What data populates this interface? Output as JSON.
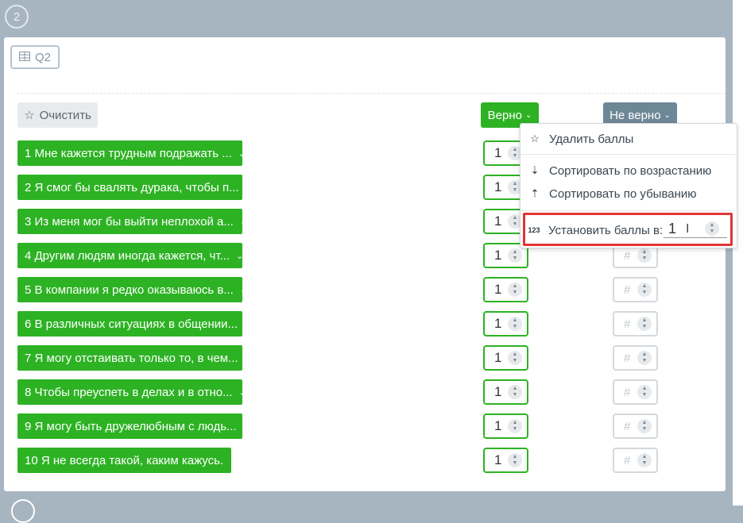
{
  "step_number": "2",
  "tag": {
    "label": "Q2"
  },
  "toolbar": {
    "clear_label": "Очистить"
  },
  "columns": {
    "true_label": "Верно",
    "false_label": "Не верно"
  },
  "questions": [
    {
      "label": "1 Мне кажется трудным подражать ...",
      "true_score": "1",
      "false_score": "#"
    },
    {
      "label": "2 Я смог бы свалять дурака, чтобы п...",
      "true_score": "1",
      "false_score": "#"
    },
    {
      "label": "3 Из меня мог бы выйти неплохой а...",
      "true_score": "1",
      "false_score": "#"
    },
    {
      "label": "4 Другим людям иногда кажется, чт...",
      "true_score": "1",
      "false_score": "#"
    },
    {
      "label": "5 В компании я редко оказываюсь в...",
      "true_score": "1",
      "false_score": "#"
    },
    {
      "label": "6 В различных ситуациях в общении...",
      "true_score": "1",
      "false_score": "#"
    },
    {
      "label": "7 Я могу отстаивать только то, в чем...",
      "true_score": "1",
      "false_score": "#"
    },
    {
      "label": "8 Чтобы преуспеть в делах и в отно...",
      "true_score": "1",
      "false_score": "#"
    },
    {
      "label": "9 Я могу быть дружелюбным с людь...",
      "true_score": "1",
      "false_score": "#"
    },
    {
      "label": "10 Я не всегда такой, каким кажусь.",
      "true_score": "1",
      "false_score": "#"
    }
  ],
  "menu": {
    "delete_scores": "Удалить баллы",
    "sort_asc": "Сортировать по возрастанию",
    "sort_desc": "Сортировать по убыванию",
    "set_scores_label": "Установить баллы в:",
    "set_scores_value": "1",
    "set_scores_icon": "123"
  },
  "colors": {
    "accent_green": "#2db224",
    "accent_slate": "#6d8797",
    "highlight_red": "#e03535"
  }
}
